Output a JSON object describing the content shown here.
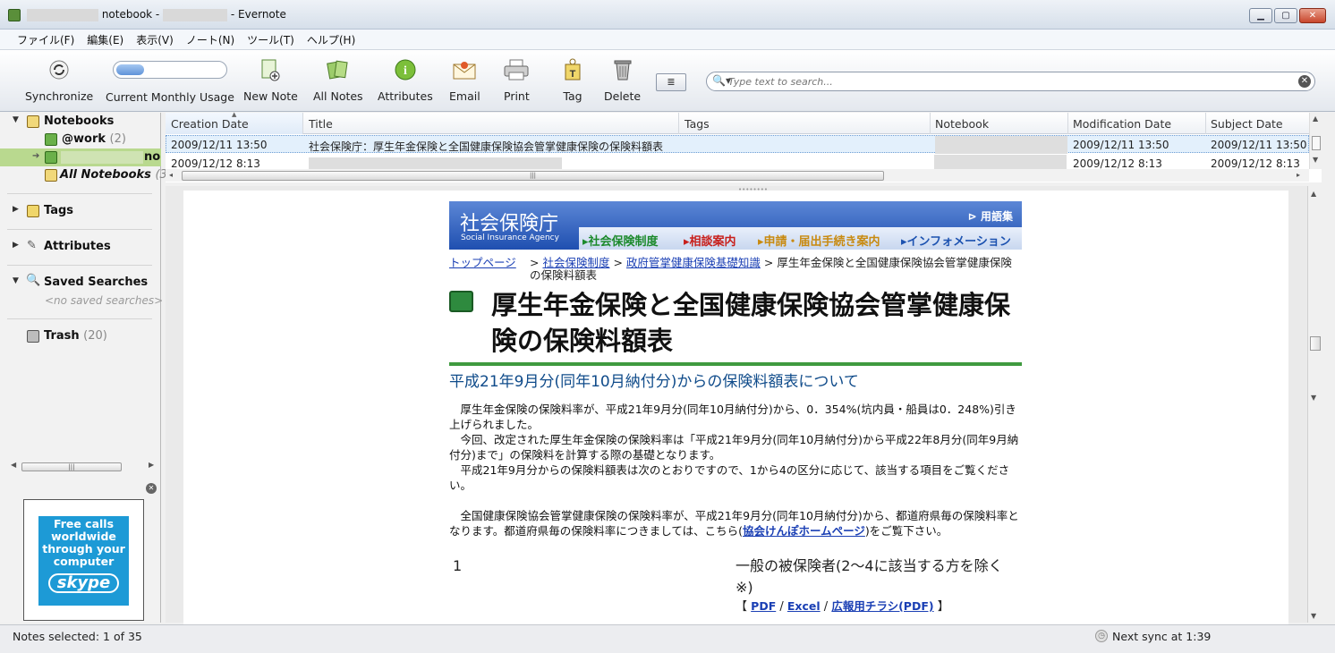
{
  "window": {
    "title_suffix": "notebook - ",
    "title_app": " - Evernote"
  },
  "menu": [
    "ファイル(F)",
    "編集(E)",
    "表示(V)",
    "ノート(N)",
    "ツール(T)",
    "ヘルプ(H)"
  ],
  "toolbar": {
    "synchronize": "Synchronize",
    "usage": "Current Monthly Usage",
    "usage_fraction": 0.25,
    "new_note": "New Note",
    "all_notes": "All Notes",
    "attributes": "Attributes",
    "email": "Email",
    "print": "Print",
    "tag": "Tag",
    "delete": "Delete"
  },
  "search": {
    "placeholder": "Type text to search..."
  },
  "sidebar": {
    "notebooks": "Notebooks",
    "work": "@work",
    "work_count": "(2)",
    "selected_suffix": "no",
    "all_notebooks": "All Notebooks",
    "all_notebooks_count": "(3",
    "tags": "Tags",
    "attributes": "Attributes",
    "saved_searches": "Saved Searches",
    "no_saved": "<no saved searches>",
    "trash": "Trash",
    "trash_count": "(20)"
  },
  "ad": {
    "line1": "Free calls",
    "line2": "worldwide",
    "line3": "through your",
    "line4": "computer",
    "brand": "skype"
  },
  "notelist": {
    "columns": [
      "Creation Date",
      "Title",
      "Tags",
      "Notebook",
      "Modification Date",
      "Subject Date"
    ],
    "rows": [
      {
        "created": "2009/12/11 13:50",
        "title": "社会保険庁：厚生年金保険と全国健康保険協会管掌健康保険の保険料額表",
        "modified": "2009/12/11 13:50",
        "subject": "2009/12/11 13:50"
      },
      {
        "created": "2009/12/12 8:13",
        "title": "",
        "modified": "2009/12/12 8:13",
        "subject": "2009/12/12 8:13"
      }
    ]
  },
  "note": {
    "agency_name": "社会保険庁",
    "agency_en": "Social Insurance Agency",
    "glossary": "用語集",
    "nav": [
      "社会保険制度",
      "相談案内",
      "申請・届出手続き案内",
      "インフォメーション"
    ],
    "nav_colors": [
      "#1c8a2c",
      "#c8201c",
      "#c88a10",
      "#1c52b0"
    ],
    "crumb_top": "トップページ",
    "crumb_sep1": "> ",
    "crumb_link1": "社会保険制度",
    "crumb_sep2": " > ",
    "crumb_link2": "政府管掌健康保険基礎知識",
    "crumb_tail": " > 厚生年金保険と全国健康保険協会管掌健康保険の保険料額表",
    "heading": "厚生年金保険と全国健康保険協会管掌健康保険の保険料額表",
    "subheading": "平成21年9月分(同年10月納付分)からの保険料額表について",
    "para1": "　厚生年金保険の保険料率が、平成21年9月分(同年10月納付分)から、0．354%(坑内員・船員は0．248%)引き上げられました。",
    "para2": "　今回、改定された厚生年金保険の保険料率は「平成21年9月分(同年10月納付分)から平成22年8月分(同年9月納付分)まで」の保険料を計算する際の基礎となります。",
    "para3": "　平成21年9月分からの保険料額表は次のとおりですので、1から4の区分に応じて、該当する項目をご覧ください。",
    "para4_a": "　全国健康保険協会管掌健康保険の保険料率が、平成21年9月分(同年10月納付分)から、都道府県毎の保険料率となります。都道府県毎の保険料率につきましては、こちら(",
    "para4_link": "協会けんぽホームページ",
    "para4_b": ")をご覧下さい。",
    "table_num": "1",
    "table_head": "一般の被保険者(2～4に該当する方を除く※)",
    "bracket_open": "【",
    "link_pdf": "PDF",
    "slash": " / ",
    "link_excel": "Excel",
    "link_flyer": "広報用チラシ(PDF)",
    "bracket_close": "】"
  },
  "status": {
    "left": "Notes selected: 1 of 35",
    "right": "Next sync at 1:39"
  }
}
